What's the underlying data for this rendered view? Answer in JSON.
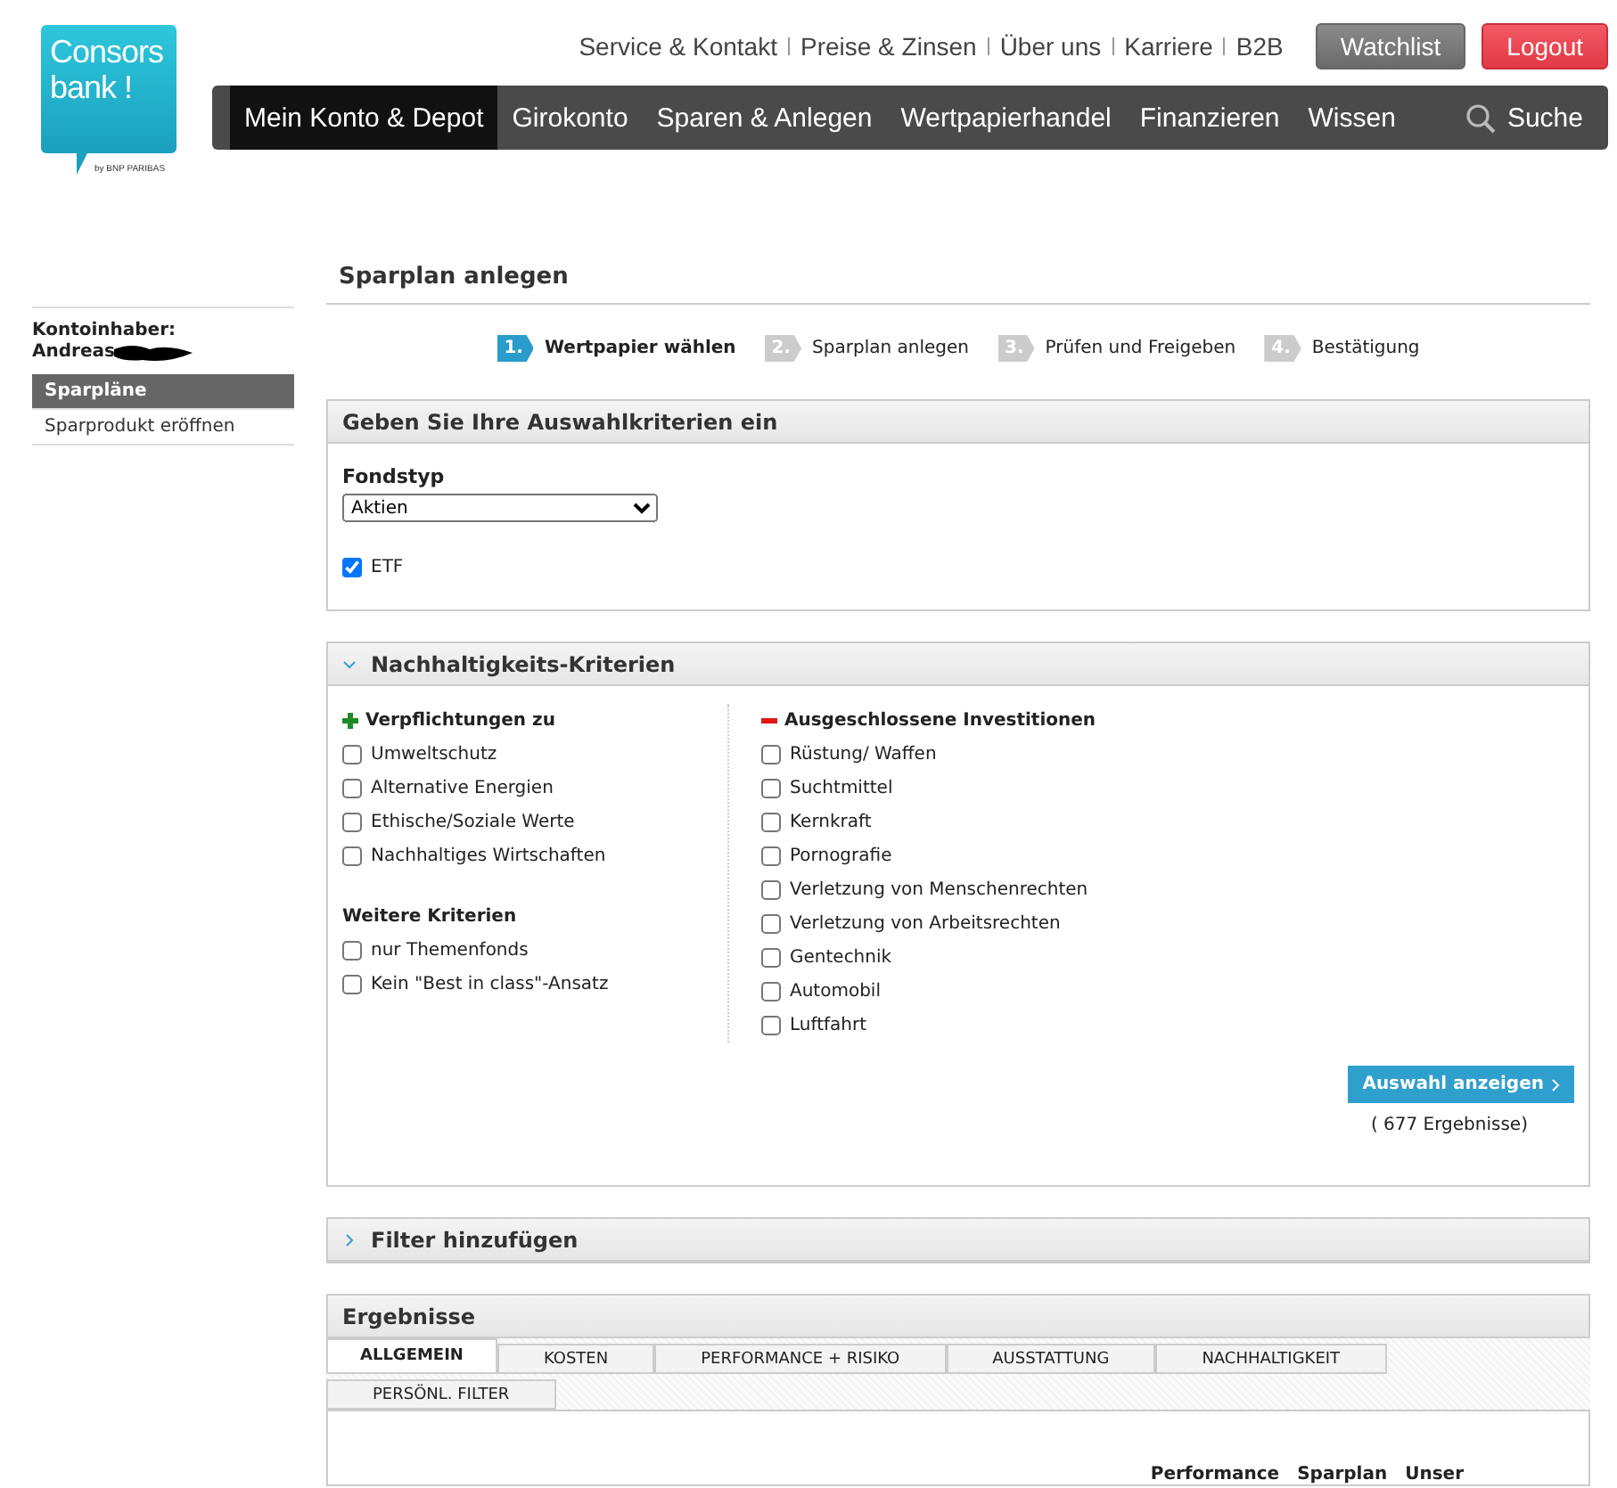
{
  "logo": {
    "line_1": "Consors",
    "line_2": "bank !",
    "tagline": "by BNP PARIBAS"
  },
  "top_links": [
    "Service & Kontakt",
    "Preise & Zinsen",
    "Über uns",
    "Karriere",
    "B2B"
  ],
  "header_buttons": [
    {
      "label": "Watchlist",
      "kind": "secondary"
    },
    {
      "label": "Logout",
      "kind": "danger"
    }
  ],
  "nav": [
    {
      "label": "Mein Konto & Depot",
      "selected": true
    },
    {
      "label": "Girokonto",
      "selected": false
    },
    {
      "label": "Sparen & Anlegen",
      "selected": false
    },
    {
      "label": "Wertpapierhandel",
      "selected": false
    },
    {
      "label": "Finanzieren",
      "selected": false
    },
    {
      "label": "Wissen",
      "selected": false
    }
  ],
  "search": {
    "label": "Suche"
  },
  "sidebar": {
    "owner_label": "Kontoinhaber:",
    "owner_name": "Andreas",
    "items": [
      {
        "label": "Sparpläne",
        "selected": true
      },
      {
        "label": "Sparprodukt eröffnen",
        "selected": false
      }
    ]
  },
  "page_title": "Sparplan anlegen",
  "steps": [
    {
      "number": "1.",
      "label": "Wertpapier wählen",
      "selected": true
    },
    {
      "number": "2.",
      "label": "Sparplan anlegen",
      "selected": false
    },
    {
      "number": "3.",
      "label": "Prüfen und Freigeben",
      "selected": false
    },
    {
      "number": "4.",
      "label": "Bestätigung",
      "selected": false
    }
  ],
  "criteria_panel": {
    "title": "Geben Sie Ihre Auswahlkriterien ein",
    "fund_type_label": "Fondstyp",
    "fund_type_value": "Aktien",
    "etf": {
      "label": "ETF",
      "checked": true
    }
  },
  "sustainability_panel": {
    "title": "Nachhaltigkeits-Kriterien",
    "expanded": true,
    "commitments": {
      "title": "Verpflichtungen zu",
      "items": [
        {
          "label": "Umweltschutz",
          "checked": false
        },
        {
          "label": "Alternative Energien",
          "checked": false
        },
        {
          "label": "Ethische/Soziale Werte",
          "checked": false
        },
        {
          "label": "Nachhaltiges Wirtschaften",
          "checked": false
        }
      ]
    },
    "further": {
      "title": "Weitere Kriterien",
      "items": [
        {
          "label": "nur Themenfonds",
          "checked": false
        },
        {
          "label": "Kein \"Best in class\"-Ansatz",
          "checked": false
        }
      ]
    },
    "excluded": {
      "title": "Ausgeschlossene Investitionen",
      "items": [
        {
          "label": "Rüstung/ Waffen",
          "checked": false
        },
        {
          "label": "Suchtmittel",
          "checked": false
        },
        {
          "label": "Kernkraft",
          "checked": false
        },
        {
          "label": "Pornografie",
          "checked": false
        },
        {
          "label": "Verletzung von Menschenrechten",
          "checked": false
        },
        {
          "label": "Verletzung von Arbeitsrechten",
          "checked": false
        },
        {
          "label": "Gentechnik",
          "checked": false
        },
        {
          "label": "Automobil",
          "checked": false
        },
        {
          "label": "Luftfahrt",
          "checked": false
        }
      ]
    },
    "button": "Auswahl anzeigen",
    "result_count": "( 677 Ergebnisse)"
  },
  "filter_panel": {
    "title": "Filter hinzufügen",
    "expanded": false
  },
  "results": {
    "title": "Ergebnisse",
    "tabs": [
      {
        "label": "ALLGEMEIN",
        "selected": true
      },
      {
        "label": "KOSTEN",
        "selected": false
      },
      {
        "label": "PERFORMANCE + RISIKO",
        "selected": false
      },
      {
        "label": "AUSSTATTUNG",
        "selected": false
      },
      {
        "label": "NACHHALTIGKEIT",
        "selected": false
      },
      {
        "label": "PERSÖNL. FILTER",
        "selected": false
      }
    ],
    "columns": [
      "Performance",
      "Sparplan",
      "Unser"
    ]
  }
}
